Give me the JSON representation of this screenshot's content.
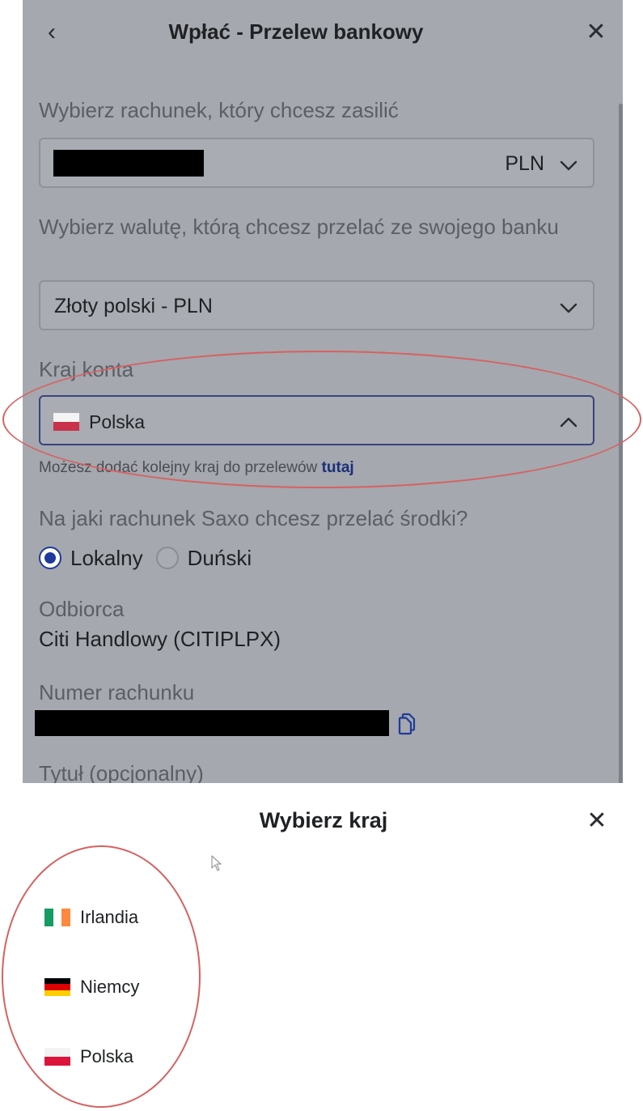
{
  "header": {
    "back_icon": "chevron-left-icon",
    "title": "Wpłać - Przelew bankowy",
    "close_icon": "close-icon"
  },
  "account": {
    "label": "Wybierz rachunek, który chcesz zasilić",
    "currency": "PLN"
  },
  "bank_currency": {
    "label": "Wybierz walutę, którą chcesz przelać ze swojego banku",
    "value": "Złoty polski - PLN"
  },
  "country": {
    "label": "Kraj konta",
    "value": "Polska",
    "hint_text": "Możesz dodać kolejny kraj do przelewów ",
    "hint_link": "tutaj"
  },
  "saxo_account": {
    "label": "Na jaki rachunek Saxo chcesz przelać środki?",
    "options": [
      {
        "label": "Lokalny",
        "selected": true
      },
      {
        "label": "Duński",
        "selected": false
      }
    ]
  },
  "recipient": {
    "label": "Odbiorca",
    "value": "Citi Handlowy (CITIPLPX)"
  },
  "account_number": {
    "label": "Numer rachunku"
  },
  "transfer_title": {
    "label": "Tytuł (opcjonalny)"
  },
  "country_sheet": {
    "title": "Wybierz kraj",
    "items": [
      {
        "name": "Irlandia",
        "flag_colors": [
          "#169b62",
          "#ffffff",
          "#ff883e"
        ]
      },
      {
        "name": "Niemcy",
        "flag_colors": [
          "#000000",
          "#dd0000",
          "#ffce00"
        ]
      },
      {
        "name": "Polska",
        "flag_colors": [
          "#f3f3f3",
          "#dc143c"
        ]
      }
    ]
  },
  "colors": {
    "accent": "#1f3a9a",
    "annotation": "#d66161"
  }
}
